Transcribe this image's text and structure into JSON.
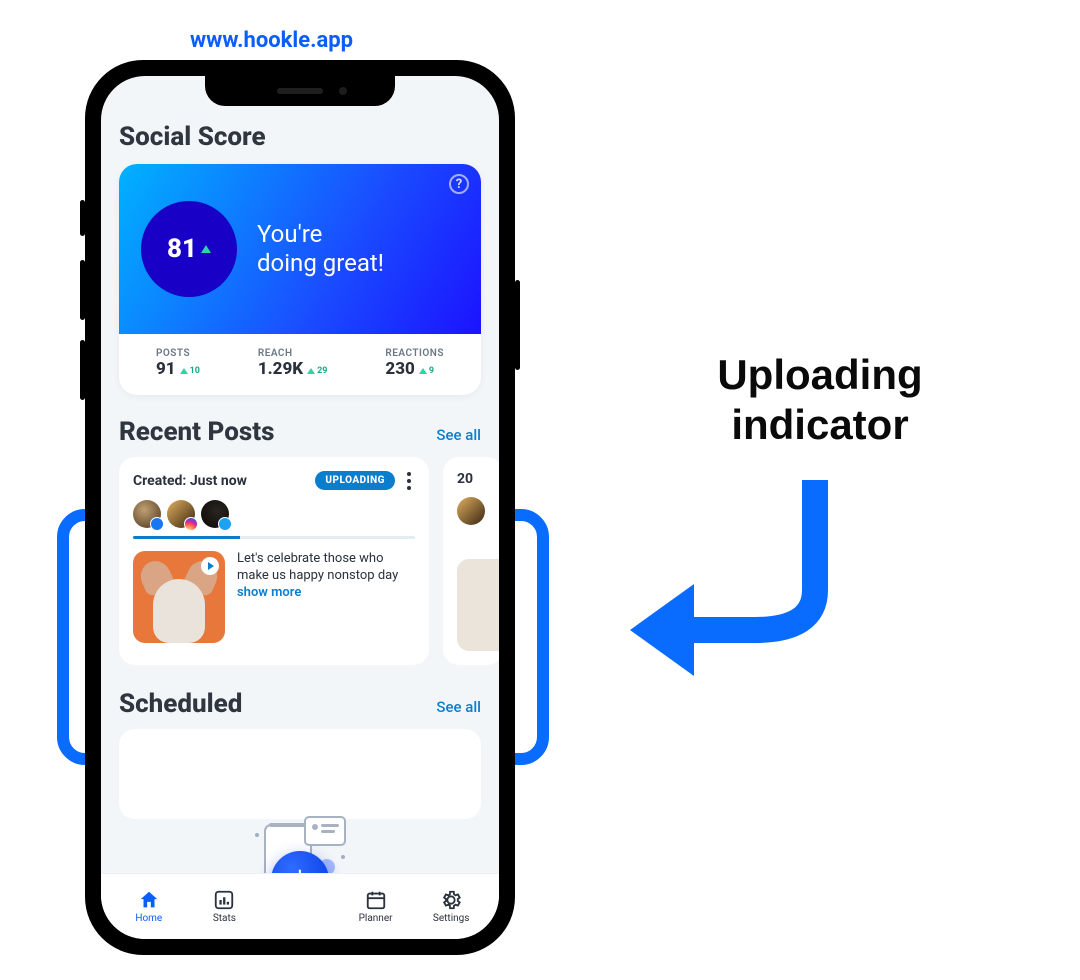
{
  "url": "www.hookle.app",
  "annotation": {
    "line1": "Uploading",
    "line2": "indicator"
  },
  "score_section": {
    "title": "Social Score",
    "score": "81",
    "message_line1": "You're",
    "message_line2": "doing great!",
    "help": "?"
  },
  "stats": {
    "posts": {
      "label": "POSTS",
      "value": "91",
      "delta": "10"
    },
    "reach": {
      "label": "REACH",
      "value": "1.29K",
      "delta": "29"
    },
    "reactions": {
      "label": "REACTIONS",
      "value": "230",
      "delta": "9"
    }
  },
  "recent": {
    "title": "Recent Posts",
    "see_all": "See all",
    "post": {
      "created_label": "Created: Just now",
      "badge": "UPLOADING",
      "text": "Let's celebrate those who make us happy nonstop day",
      "show_more": "show more"
    },
    "peek_date": "20"
  },
  "scheduled": {
    "title": "Scheduled",
    "see_all": "See all"
  },
  "nav": {
    "home": "Home",
    "stats": "Stats",
    "planner": "Planner",
    "settings": "Settings",
    "fab": "+"
  }
}
